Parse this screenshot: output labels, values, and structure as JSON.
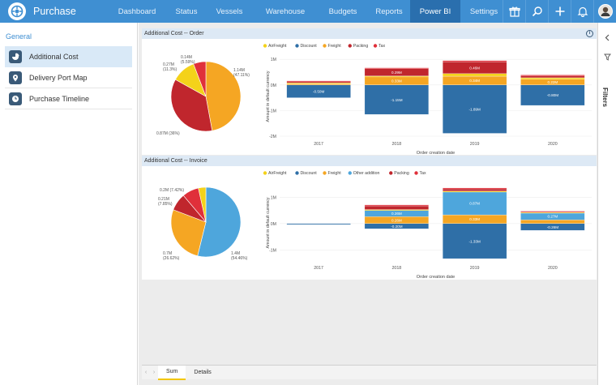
{
  "app": {
    "name": "Purchase"
  },
  "nav": [
    "Dashboard",
    "Status",
    "Vessels",
    "Warehouse",
    "Budgets",
    "Reports",
    "Power BI",
    "Settings"
  ],
  "nav_active": "Power BI",
  "top_icons": [
    "gift-icon",
    "search-icon",
    "plus-icon",
    "bell-icon",
    "avatar"
  ],
  "sidebar": {
    "title": "General",
    "items": [
      {
        "label": "Additional Cost",
        "icon": "pie-chart-icon",
        "active": true
      },
      {
        "label": "Delivery Port Map",
        "icon": "map-pin-icon",
        "active": false
      },
      {
        "label": "Purchase Timeline",
        "icon": "clock-icon",
        "active": false
      }
    ]
  },
  "filters": {
    "label": "Filters"
  },
  "tabs": {
    "items": [
      "Sum",
      "Details"
    ],
    "active": "Sum"
  },
  "colors": {
    "AirFreight": "#f4d21a",
    "Discount": "#2f6fa7",
    "Freight": "#f5a623",
    "Packing": "#c0262d",
    "Tax": "#e0303a",
    "Other addition": "#4ea6dc"
  },
  "chart_data": [
    {
      "title": "Additional Cost -- Order",
      "pie": {
        "type": "pie",
        "slices": [
          {
            "name": "Freight",
            "value": 1.14,
            "label": "1.14M\n(47.11%)"
          },
          {
            "name": "Packing",
            "value": 0.87,
            "label": "0.87M (36%)"
          },
          {
            "name": "AirFreight",
            "value": 0.27,
            "label": "0.27M\n(11.3%)"
          },
          {
            "name": "Tax",
            "value": 0.14,
            "label": "0.14M\n(5.59%)"
          }
        ]
      },
      "bar": {
        "type": "bar",
        "stacked": true,
        "legend": [
          "AirFreight",
          "Discount",
          "Freight",
          "Packing",
          "Tax"
        ],
        "categories": [
          "2017",
          "2018",
          "2019",
          "2020"
        ],
        "xlabel": "Order creation date",
        "ylabel": "Amount in default currency",
        "yticks": [
          "1M",
          "0M",
          "-1M",
          "-2M"
        ],
        "ylim": [
          -2,
          1.1
        ],
        "series": [
          {
            "name": "Discount",
            "values": [
              -0.5,
              -1.15,
              -1.89,
              -0.8
            ],
            "labels": [
              "-0.50M",
              "-1.15M",
              "-1.89M",
              "-0.80M"
            ]
          },
          {
            "name": "Freight",
            "values": [
              0.05,
              0.33,
              0.34,
              0.22
            ],
            "labels": [
              "",
              "0.33M",
              "0.34M",
              "0.22M"
            ]
          },
          {
            "name": "AirFreight",
            "values": [
              0.03,
              0.02,
              0.1,
              0.06
            ],
            "labels": [
              "",
              "",
              "",
              ""
            ]
          },
          {
            "name": "Packing",
            "values": [
              0.06,
              0.29,
              0.46,
              0.08
            ],
            "labels": [
              "",
              "0.29M",
              "0.46M",
              ""
            ]
          },
          {
            "name": "Tax",
            "values": [
              0.02,
              0.03,
              0.05,
              0.03
            ],
            "labels": [
              "",
              "",
              "",
              ""
            ]
          }
        ]
      }
    },
    {
      "title": "Additional Cost -- Invoice",
      "pie": {
        "type": "pie",
        "slices": [
          {
            "name": "Other addition",
            "value": 1.4,
            "label": "1.4M\n(54.46%)"
          },
          {
            "name": "Freight",
            "value": 0.7,
            "label": "0.7M\n(26.62%)"
          },
          {
            "name": "Packing",
            "value": 0.21,
            "label": "0.21M\n(7.85%)"
          },
          {
            "name": "Tax",
            "value": 0.2,
            "label": "0.2M (7.42%)"
          },
          {
            "name": "AirFreight",
            "value": 0.09,
            "label": ""
          }
        ]
      },
      "bar": {
        "type": "bar",
        "stacked": true,
        "legend": [
          "AirFreight",
          "Discount",
          "Freight",
          "Other addition",
          "Packing",
          "Tax"
        ],
        "categories": [
          "2017",
          "2018",
          "2019",
          "2020"
        ],
        "xlabel": "Order creation date",
        "ylabel": "Amount in default currency",
        "yticks": [
          "1M",
          "0M",
          "-1M"
        ],
        "ylim": [
          -1.45,
          1.5
        ],
        "series": [
          {
            "name": "Discount",
            "values": [
              -0.02,
              -0.2,
              -1.33,
              -0.26
            ],
            "labels": [
              "",
              "-0.20M",
              "-1.33M",
              "-0.26M"
            ]
          },
          {
            "name": "Freight",
            "values": [
              0,
              0.26,
              0.33,
              0.14
            ],
            "labels": [
              "",
              "0.26M",
              "0.33M",
              ""
            ]
          },
          {
            "name": "Other addition",
            "values": [
              0,
              0.26,
              0.87,
              0.27
            ],
            "labels": [
              "",
              "0.26M",
              "0.87M",
              "0.27M"
            ]
          },
          {
            "name": "AirFreight",
            "values": [
              0,
              0.01,
              0.03,
              0.02
            ],
            "labels": [
              "",
              "",
              "",
              ""
            ]
          },
          {
            "name": "Packing",
            "values": [
              0,
              0.14,
              0.09,
              0.03
            ],
            "labels": [
              "",
              "",
              "",
              ""
            ]
          },
          {
            "name": "Tax",
            "values": [
              0,
              0.04,
              0.03,
              0.01
            ],
            "labels": [
              "",
              "",
              "",
              ""
            ]
          }
        ]
      }
    }
  ]
}
